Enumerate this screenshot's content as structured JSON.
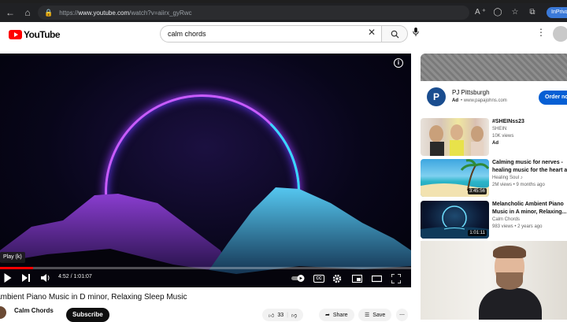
{
  "browser": {
    "url_prefix": "https://",
    "url_host": "www.youtube.com",
    "url_path": "/watch?v=aiirx_gyRwc",
    "inprivate_label": "InPrivate"
  },
  "header": {
    "logo_text": "YouTube",
    "search_value": "calm chords"
  },
  "player": {
    "tooltip": "Play (k)",
    "time_current": "4:52",
    "time_total": "1:01:07",
    "progress_fraction": 0.08,
    "cc_label": "CC"
  },
  "video": {
    "title": "Ambient Piano Music in D minor, Relaxing Sleep Music",
    "channel": "Calm Chords",
    "subscribe_label": "Subscribe",
    "likes": "33",
    "share_label": "Share",
    "save_label": "Save"
  },
  "sidebar": {
    "ad": {
      "name": "PJ Pittsburgh",
      "ad_badge": "Ad",
      "domain": "www.papajohns.com",
      "cta": "Order now"
    },
    "items": [
      {
        "title": "#SHEINss23",
        "line1": "SHEIN",
        "line2": "10K views",
        "badge": "Ad",
        "duration": ""
      },
      {
        "title": "Calming music for nerves -",
        "title2": "healing music for the heart and",
        "line1": "Healing Soul ♪",
        "line2": "2M views • 9 months ago",
        "duration": "3:45:56"
      },
      {
        "title": "Melancholic Ambient Piano",
        "title2": "Music in A minor, Relaxing...",
        "line1": "Calm Chords",
        "line2": "983 views • 2 years ago",
        "duration": "1:01:11"
      }
    ]
  },
  "colors": {
    "brand_red": "#ff0000",
    "cta_blue": "#065fd4",
    "ring_purple": "#c85cff",
    "ring_cyan": "#38d7ff"
  }
}
